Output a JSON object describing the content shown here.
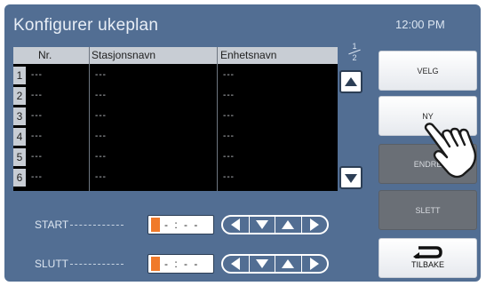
{
  "title": "Konfigurer ukeplan",
  "clock": "12:00 PM",
  "table": {
    "headers": [
      "Nr.",
      "Stasjonsnavn",
      "Enhetsnavn"
    ],
    "rows": [
      {
        "num": "1",
        "nr": "---",
        "station": "---",
        "unit": "---"
      },
      {
        "num": "2",
        "nr": "---",
        "station": "---",
        "unit": "---"
      },
      {
        "num": "3",
        "nr": "---",
        "station": "---",
        "unit": "---"
      },
      {
        "num": "4",
        "nr": "---",
        "station": "---",
        "unit": "---"
      },
      {
        "num": "5",
        "nr": "---",
        "station": "---",
        "unit": "---"
      },
      {
        "num": "6",
        "nr": "---",
        "station": "---",
        "unit": "---"
      }
    ]
  },
  "pager": {
    "current": "1",
    "total": "2"
  },
  "start": {
    "label": "START",
    "value": "- : - -"
  },
  "stop": {
    "label": "SLUTT",
    "value": "- : - -"
  },
  "buttons": {
    "select": "VELG",
    "new": "NY",
    "edit": "ENDRE",
    "delete": "SLETT",
    "back": "TILBAKE"
  },
  "colors": {
    "background": "#526e93",
    "cursor": "#f07a2a",
    "disabled_button": "#6a6f76"
  },
  "icons": [
    "scroll-up-icon",
    "scroll-down-icon",
    "arrow-left-icon",
    "arrow-down-icon",
    "arrow-up-icon",
    "arrow-right-icon",
    "back-arrow-icon",
    "pointing-hand-icon"
  ]
}
